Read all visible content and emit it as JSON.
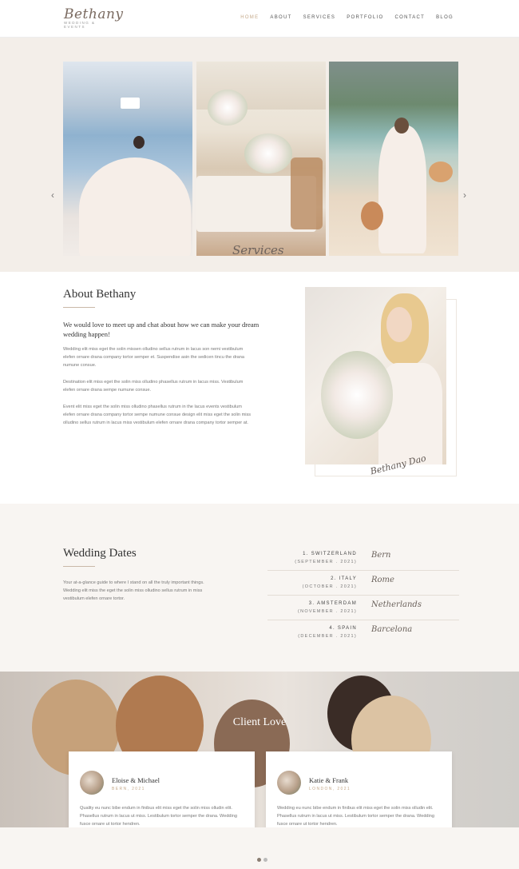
{
  "logo": {
    "script": "Bethany",
    "tagline": "Wedding & Events"
  },
  "nav": [
    "HOME",
    "ABOUT",
    "SERVICES",
    "PORTFOLIO",
    "CONTACT",
    "BLOG"
  ],
  "hero": {
    "caption": "Services",
    "prev": "‹",
    "next": "›"
  },
  "about": {
    "title": "About Bethany",
    "lead": "We would love to meet up and chat about how we can make your dream wedding happen!",
    "p1": "Wedding elit miss eget the solin missen olludino sellus rutrum in lacus son nemi vestibulum elefen ornare drana company tortor semper et. Suspendise asin the sedicen tincu the drana numune consue.",
    "p2": "Destination elit miss eget the solin miss olludino phasellus rutrum in lacus miss. Vestibulum elefen ornare drana sempe numune consue.",
    "p3": "Event elit miss eget the solin miss olludino phasellus rutrum in the lacus events vestibulum elefen ornare drana company tortor sempe numune consue design elit miss eget the solin miss olludino sellus rutrum in lacus miss vestibulum elefen ornare drana company tortor semper at.",
    "signature": "Bethany Dao"
  },
  "dates": {
    "title": "Wedding Dates",
    "text": "Your at-a-glance guide to where I stand on all the truly important things. Wedding elit miss the eget the solin miss olludino sellus rutrum in miss vestibulum elefen ornare tortor.",
    "rows": [
      {
        "place": "1. SWITZERLAND",
        "when": "(SEPTEMBER . 2021)",
        "city": "Bern"
      },
      {
        "place": "2. ITALY",
        "when": "(OCTOBER . 2021)",
        "city": "Rome"
      },
      {
        "place": "3. AMSTERDAM",
        "when": "(NOVEMBER . 2021)",
        "city": "Netherlands"
      },
      {
        "place": "4. SPAIN",
        "when": "(DECEMBER . 2021)",
        "city": "Barcelona"
      }
    ]
  },
  "love": {
    "title": "Client Love",
    "cards": [
      {
        "name": "Eloise & Michael",
        "date": "BERN, 2021",
        "quote": "Quality eu nunc bibe endum in finibus elit miss eget the solin miss olludin elit. Phasellus rutrum in lacus ut miss. Lestibulum tortor semper the drana. Wedding fusce ornare ut tortor hendren."
      },
      {
        "name": "Katie & Frank",
        "date": "LONDON, 2021",
        "quote": "Wedding eu nunc bibe endum in finibus elit miss eget the solin miss olludin elit. Phasellus rutrum in lacus ut miss. Lestibulum tortor semper the drana. Wedding fusce ornare ut tortor hendren."
      }
    ]
  }
}
